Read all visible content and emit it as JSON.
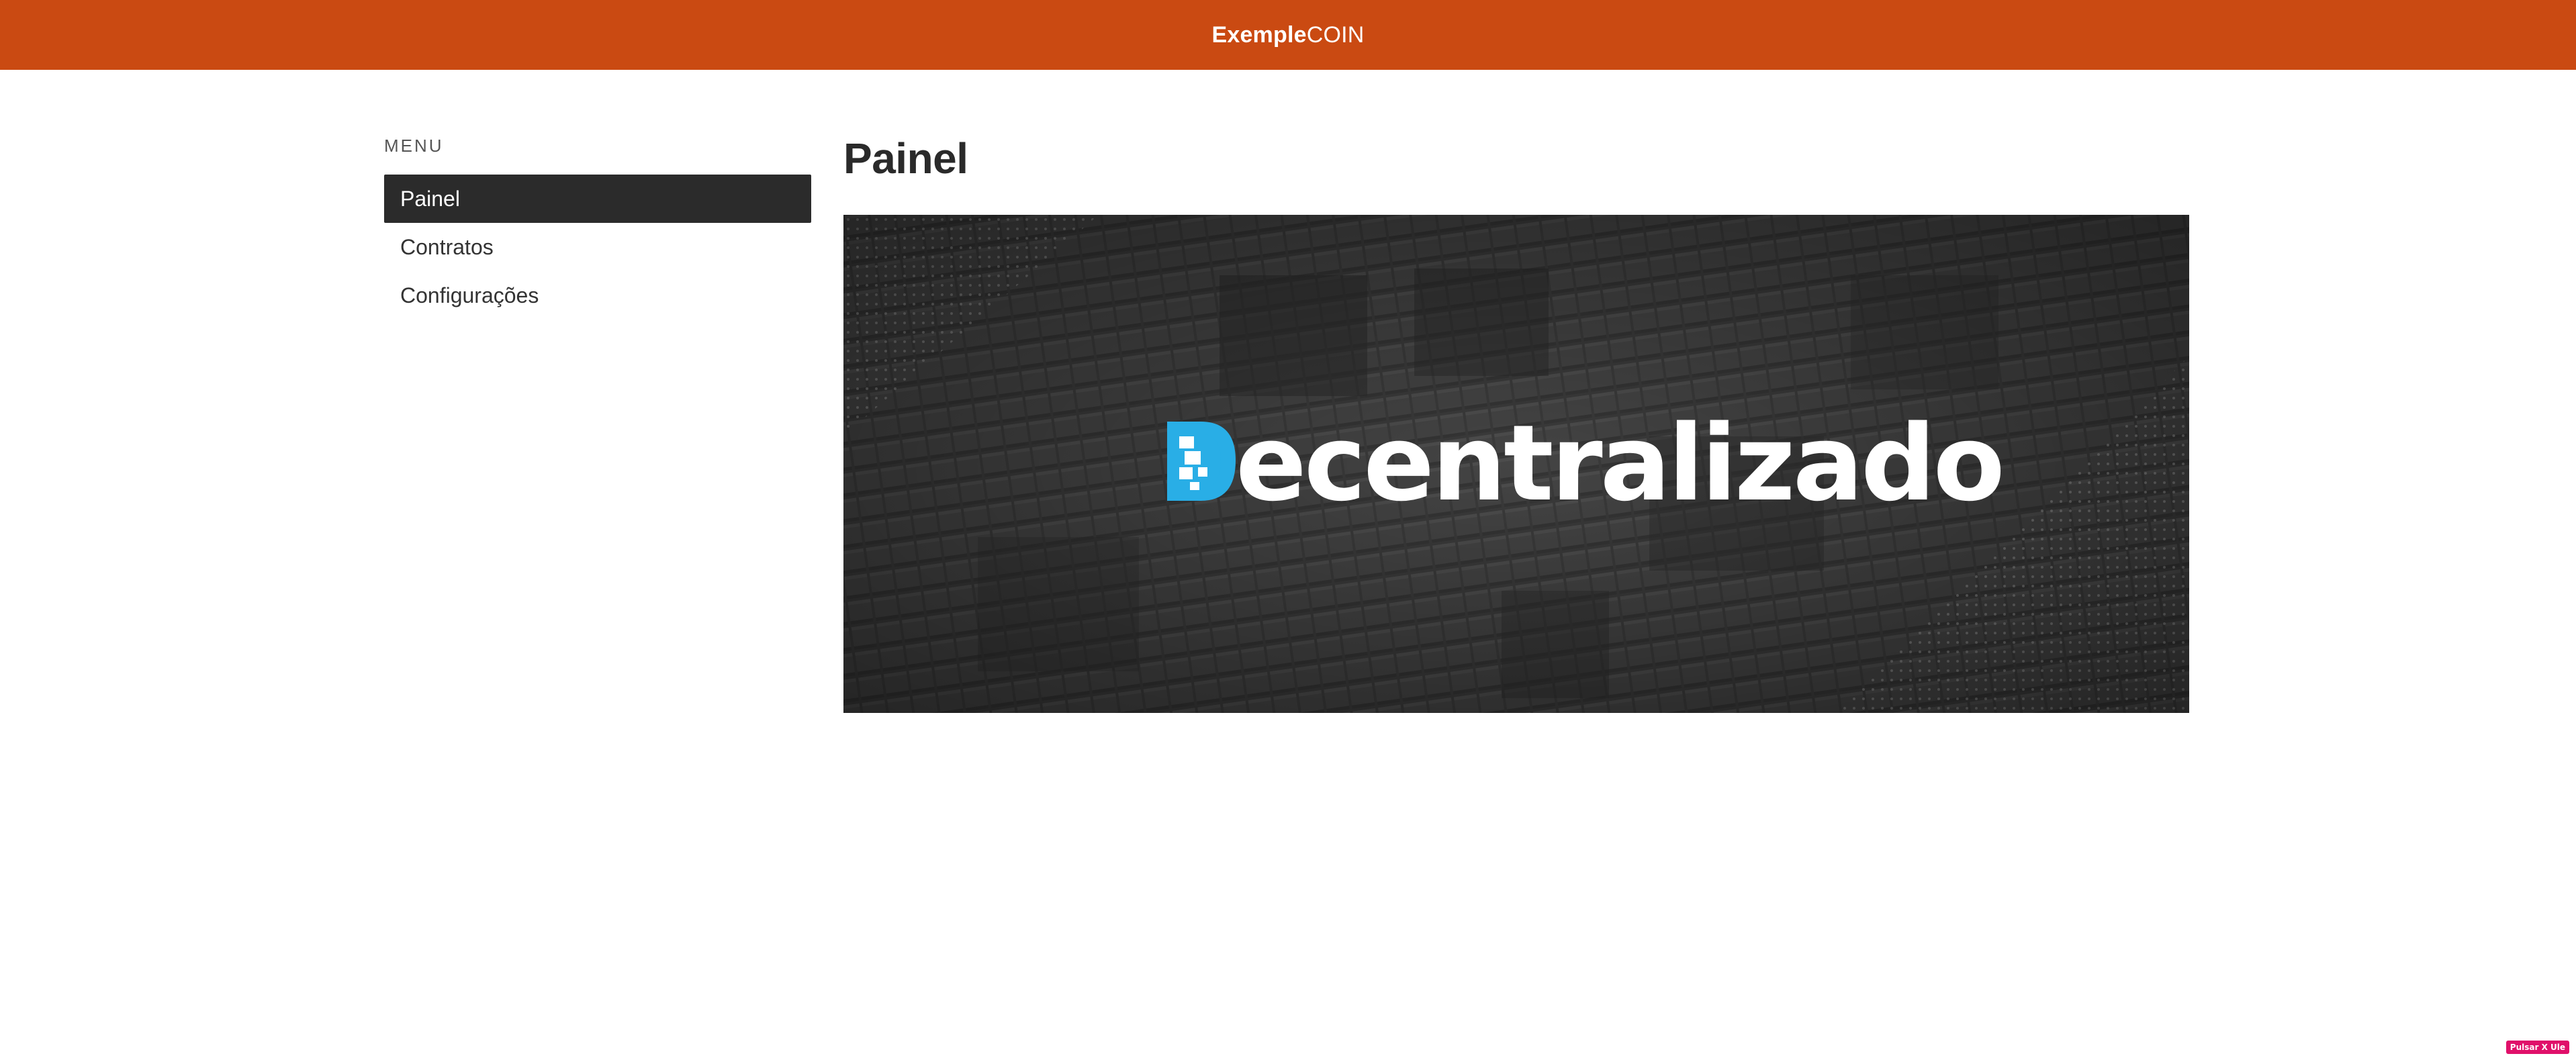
{
  "navbar": {
    "brand_strong": "Exemple",
    "brand_light": "COIN",
    "color": "#ca4a12"
  },
  "sidebar": {
    "header": "MENU",
    "items": [
      {
        "label": "Painel",
        "active": true
      },
      {
        "label": "Contratos",
        "active": false
      },
      {
        "label": "Configurações",
        "active": false
      }
    ]
  },
  "main": {
    "title": "Painel",
    "banner": {
      "logo_initial": "D",
      "logo_rest": "ecentralizado",
      "accent_color": "#29aee6",
      "icon": "blockchain-d-icon"
    }
  },
  "corner_badge": {
    "label": "Pulsar X Ule"
  }
}
